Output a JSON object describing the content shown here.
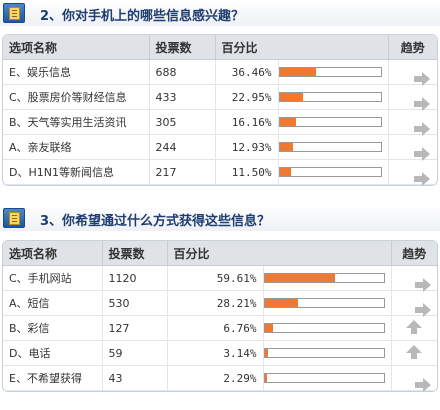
{
  "section1": {
    "title": "2、你对手机上的哪些信息感兴趣？",
    "headers": {
      "name": "选项名称",
      "votes": "投票数",
      "percent": "百分比",
      "trend": "趋势"
    },
    "rows": [
      {
        "name": "E、娱乐信息",
        "votes": "688",
        "percent": "36.46%",
        "fraction": 0.3646,
        "trend": "right-arrow-icon"
      },
      {
        "name": "C、股票房价等财经信息",
        "votes": "433",
        "percent": "22.95%",
        "fraction": 0.2295,
        "trend": "right-arrow-icon"
      },
      {
        "name": "B、天气等实用生活资讯",
        "votes": "305",
        "percent": "16.16%",
        "fraction": 0.1616,
        "trend": "right-arrow-icon"
      },
      {
        "name": "A、亲友联络",
        "votes": "244",
        "percent": "12.93%",
        "fraction": 0.1293,
        "trend": "right-arrow-icon"
      },
      {
        "name": "D、H1N1等新闻信息",
        "votes": "217",
        "percent": "11.50%",
        "fraction": 0.115,
        "trend": "right-arrow-icon"
      }
    ]
  },
  "section2": {
    "title": "3、你希望通过什么方式获得这些信息？",
    "headers": {
      "name": "选项名称",
      "votes": "投票数",
      "percent": "百分比",
      "trend": "趋势"
    },
    "rows": [
      {
        "name": "C、手机网站",
        "votes": "1120",
        "percent": "59.61%",
        "fraction": 0.5961,
        "trend": "right-arrow-icon"
      },
      {
        "name": "A、短信",
        "votes": "530",
        "percent": "28.21%",
        "fraction": 0.2821,
        "trend": "right-arrow-icon"
      },
      {
        "name": "B、彩信",
        "votes": "127",
        "percent": "6.76%",
        "fraction": 0.0676,
        "trend": "up-arrow-icon"
      },
      {
        "name": "D、电话",
        "votes": "59",
        "percent": "3.14%",
        "fraction": 0.0314,
        "trend": "up-arrow-icon"
      },
      {
        "name": "E、不希望获得",
        "votes": "43",
        "percent": "2.29%",
        "fraction": 0.0229,
        "trend": "right-arrow-icon"
      }
    ]
  },
  "colors": {
    "bar_fill": "#f07830",
    "header_bg": "#dfe2e6",
    "title_color": "#1f3d70"
  }
}
